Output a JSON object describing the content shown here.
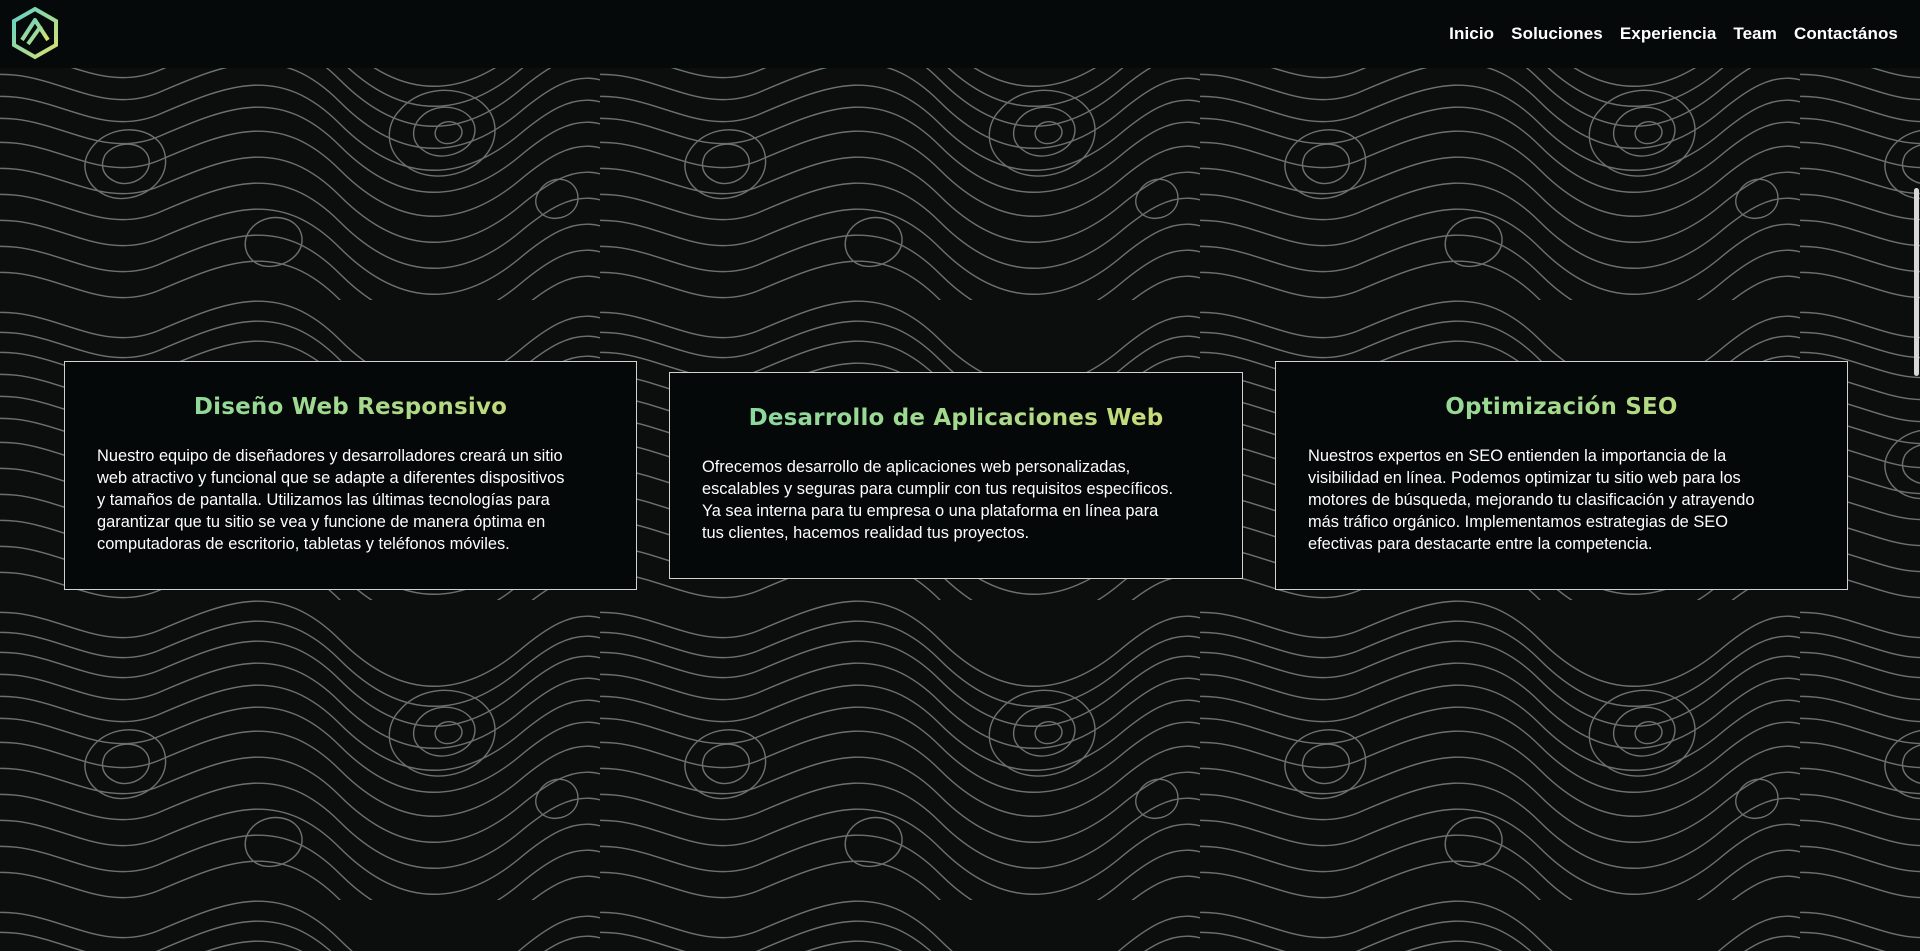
{
  "nav": {
    "logo_icon": "brand-logo-hexagon",
    "items": [
      {
        "label": "Inicio"
      },
      {
        "label": "Soluciones"
      },
      {
        "label": "Experiencia"
      },
      {
        "label": "Team"
      },
      {
        "label": "Contactános"
      }
    ]
  },
  "services": [
    {
      "title": "Diseño Web Responsivo",
      "lines": [
        "Nuestro equipo de diseñadores y desarrolladores creará un sitio",
        "web atractivo y funcional que se adapte a diferentes dispositivos",
        "y tamaños de pantalla. Utilizamos las últimas tecnologías para",
        "garantizar que tu sitio se vea y funcione de manera óptima en",
        "computadoras de escritorio, tabletas y teléfonos móviles."
      ]
    },
    {
      "title": "Desarrollo de Aplicaciones Web",
      "lines": [
        "Ofrecemos desarrollo de aplicaciones web personalizadas,",
        "escalables y seguras para cumplir con tus requisitos específicos.",
        "Ya sea interna para tu empresa o una plataforma en línea para",
        "tus clientes, hacemos realidad tus proyectos."
      ]
    },
    {
      "title": "Optimización SEO",
      "lines": [
        "Nuestros expertos en SEO entienden la importancia de la",
        "visibilidad en línea. Podemos optimizar tu sitio web para los",
        "motores de búsqueda, mejorando tu clasificación y atrayendo",
        "más tráfico orgánico. Implementamos estrategias de SEO",
        "efectivas para destacarte entre la competencia."
      ]
    }
  ],
  "colors": {
    "background": "#0b0e0d",
    "title_gradient_start": "#7fd9a4",
    "title_gradient_end": "#d8dc70",
    "card_border": "#cfd3d1",
    "contour_lines": "#8a8f8d"
  }
}
